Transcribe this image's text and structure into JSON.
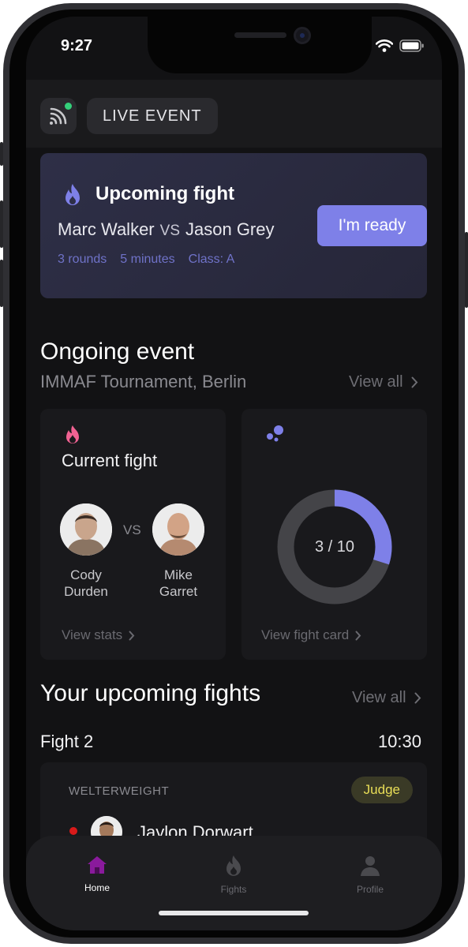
{
  "status_bar": {
    "time": "9:27"
  },
  "topbar": {
    "live_label": "LIVE EVENT"
  },
  "upcoming_fight": {
    "title": "Upcoming fight",
    "fighter_a": "Marc Walker",
    "vs": "VS",
    "fighter_b": "Jason Grey",
    "meta": [
      "3 rounds",
      "5 minutes",
      "Class: A"
    ],
    "button_label": "I'm ready"
  },
  "ongoing_event": {
    "title": "Ongoing event",
    "subtitle": "IMMAF Tournament, Berlin",
    "view_all": "View all"
  },
  "current_fight": {
    "title": "Current fight",
    "fighter_a_first": "Cody",
    "fighter_a_last": "Durden",
    "vs": "VS",
    "fighter_b_first": "Mike",
    "fighter_b_last": "Garret",
    "link": "View stats"
  },
  "fight_card": {
    "progress_label": "3 / 10",
    "current": 3,
    "total": 10,
    "link": "View fight card"
  },
  "your_upcoming": {
    "title": "Your upcoming fights",
    "view_all": "View all",
    "fight_label": "Fight 2",
    "fight_time": "10:30",
    "weight_class": "WELTERWEIGHT",
    "role_badge": "Judge",
    "fighter_name": "Jaylon Dorwart"
  },
  "tabbar": {
    "home": "Home",
    "fights": "Fights",
    "profile": "Profile"
  },
  "colors": {
    "accent": "#7e80e8",
    "home_active": "#8a1a9c",
    "flame_pink": "#f06292",
    "judge_text": "#e9de57",
    "live_dot": "#34d07a"
  }
}
